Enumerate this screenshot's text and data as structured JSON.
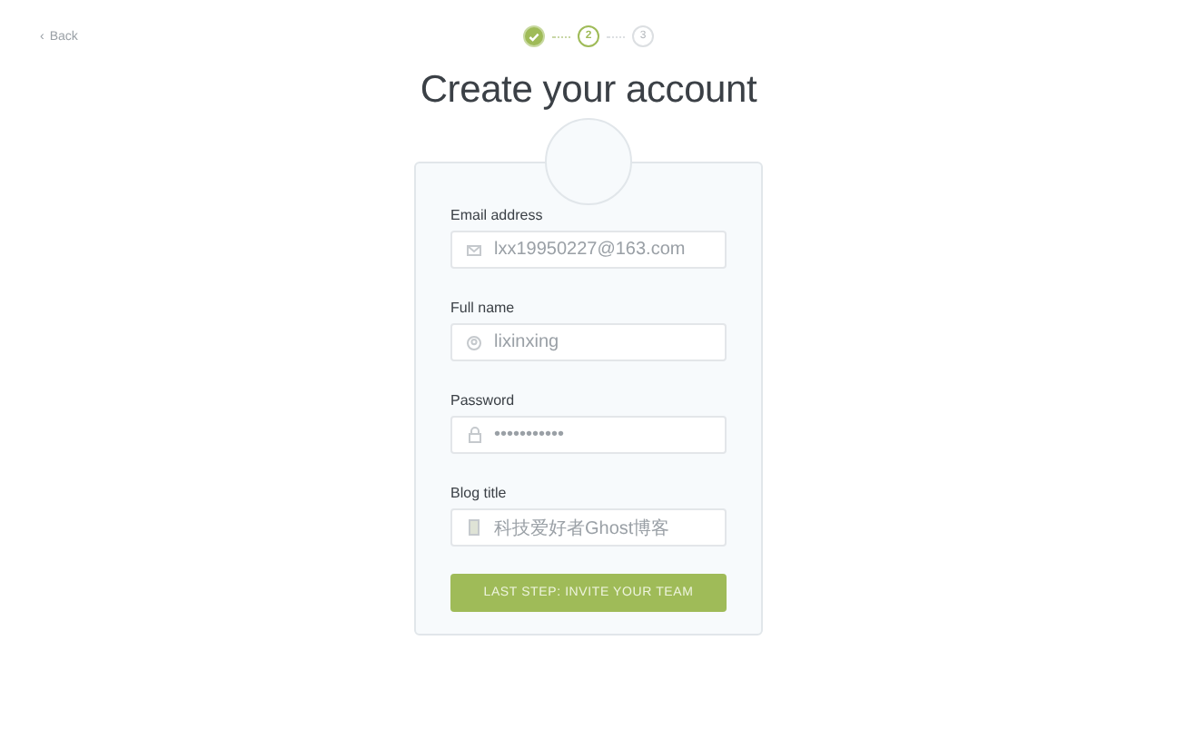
{
  "back_link": {
    "icon": "‹",
    "label": "Back"
  },
  "steps": [
    {
      "completed": true,
      "selected": false
    },
    {
      "completed": false,
      "selected": true,
      "number": "2"
    },
    {
      "completed": false,
      "selected": false,
      "number": "3"
    }
  ],
  "title": "Create your account",
  "fields": [
    {
      "label": "Email address",
      "kind": "email",
      "value": "lxx19950227@163.com"
    },
    {
      "label": "Full name",
      "kind": "person",
      "value": "lixinxing"
    },
    {
      "label": "Password",
      "kind": "lock",
      "value": "•••••••••••"
    },
    {
      "label": "Blog title",
      "kind": "book",
      "value": "科技爱好者Ghost博客"
    }
  ],
  "submit_button": "LAST STEP: INVITE YOUR TEAM"
}
